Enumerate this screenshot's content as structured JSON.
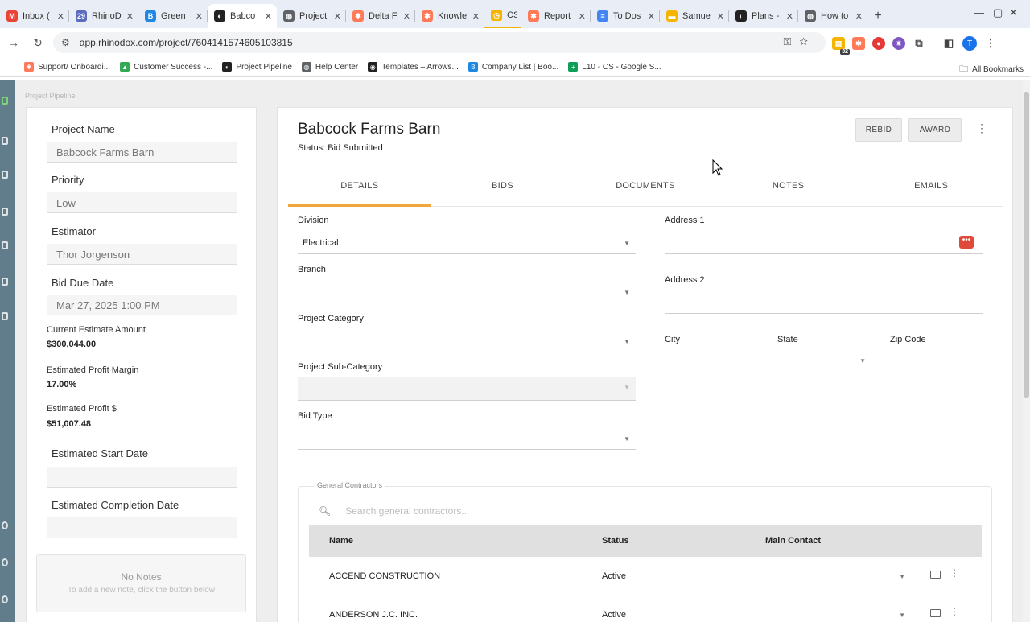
{
  "browser": {
    "tabs": [
      {
        "label": "Inbox (",
        "favicon": "gmail-icon",
        "color": "#ea4335",
        "glyph": "M"
      },
      {
        "label": "RhinoD",
        "favicon": "calendar-icon",
        "color": "#5b6bbf",
        "glyph": "29"
      },
      {
        "label": "Green",
        "favicon": "b-icon",
        "color": "#1e88e5",
        "glyph": "B"
      },
      {
        "label": "Babco",
        "favicon": "rhino-icon",
        "color": "#222222",
        "glyph": "◐"
      },
      {
        "label": "Project",
        "favicon": "globe-icon",
        "color": "#5f6368",
        "glyph": "◍"
      },
      {
        "label": "Delta F",
        "favicon": "hubspot-icon",
        "color": "#ff7a59",
        "glyph": "✱"
      },
      {
        "label": "Knowle",
        "favicon": "hubspot-icon",
        "color": "#ff7a59",
        "glyph": "✱"
      },
      {
        "label": "CS",
        "favicon": "group-icon",
        "color": "#f4b400",
        "glyph": "◷"
      },
      {
        "label": "Report",
        "favicon": "hubspot-icon",
        "color": "#ff7a59",
        "glyph": "✱"
      },
      {
        "label": "To Dos",
        "favicon": "docs-icon",
        "color": "#4285f4",
        "glyph": "≡"
      },
      {
        "label": "Samue",
        "favicon": "slides-icon",
        "color": "#f4b400",
        "glyph": "▬"
      },
      {
        "label": "Plans -",
        "favicon": "rhino-icon",
        "color": "#222222",
        "glyph": "◐"
      },
      {
        "label": "How to",
        "favicon": "globe-icon",
        "color": "#5f6368",
        "glyph": "◍"
      }
    ],
    "url": "app.rhinodox.com/project/7604141574605103815",
    "extension_badge": "32",
    "profile_initial": "T",
    "bookmarks": [
      {
        "label": "Support/ Onboardi...",
        "color": "#ff7a59",
        "glyph": "✱"
      },
      {
        "label": "Customer Success -...",
        "color": "#34a853",
        "glyph": "▲"
      },
      {
        "label": "Project Pipeline",
        "color": "#222222",
        "glyph": "◐"
      },
      {
        "label": "Help Center",
        "color": "#5f6368",
        "glyph": "◍"
      },
      {
        "label": "Templates – Arrows...",
        "color": "#222222",
        "glyph": "◉"
      },
      {
        "label": "Company List | Boo...",
        "color": "#1e88e5",
        "glyph": "B"
      },
      {
        "label": "L10 - CS - Google S...",
        "color": "#0f9d58",
        "glyph": "+"
      }
    ],
    "all_bookmarks": "All Bookmarks"
  },
  "app": {
    "breadcrumb": "Project Pipeline",
    "left": {
      "project_name_label": "Project Name",
      "project_name_value": "Babcock Farms Barn",
      "priority_label": "Priority",
      "priority_value": "Low",
      "estimator_label": "Estimator",
      "estimator_value": "Thor Jorgenson",
      "bid_due_label": "Bid Due Date",
      "bid_due_value": "Mar 27, 2025 1:00 PM",
      "current_estimate_label": "Current Estimate Amount",
      "current_estimate_value": "$300,044.00",
      "profit_margin_label": "Estimated Profit Margin",
      "profit_margin_value": "17.00%",
      "profit_dollars_label": "Estimated Profit $",
      "profit_dollars_value": "$51,007.48",
      "start_date_label": "Estimated Start Date",
      "start_date_value": "",
      "completion_date_label": "Estimated Completion Date",
      "completion_date_value": "",
      "notes_title": "No Notes",
      "notes_hint": "To add a new note, click the button below"
    },
    "main": {
      "title": "Babcock Farms Barn",
      "status": "Status: Bid Submitted",
      "rebid_label": "REBID",
      "award_label": "AWARD",
      "tabs": [
        "DETAILS",
        "BIDS",
        "DOCUMENTS",
        "NOTES",
        "EMAILS"
      ],
      "active_tab": "DETAILS",
      "accent_color": "#f0a63a",
      "division_label": "Division",
      "division_value": "Electrical",
      "branch_label": "Branch",
      "branch_value": "",
      "category_label": "Project Category",
      "category_value": "",
      "subcategory_label": "Project Sub-Category",
      "subcategory_value": "",
      "bid_type_label": "Bid Type",
      "bid_type_value": "",
      "address1_label": "Address 1",
      "address2_label": "Address 2",
      "city_label": "City",
      "state_label": "State",
      "zip_label": "Zip Code",
      "gc": {
        "legend": "General Contractors",
        "search_placeholder": "Search general contractors...",
        "columns": [
          "Name",
          "Status",
          "Main Contact"
        ],
        "rows": [
          {
            "name": "ACCEND CONSTRUCTION",
            "status": "Active"
          },
          {
            "name": "ANDERSON J.C. INC.",
            "status": "Active"
          }
        ]
      }
    }
  }
}
